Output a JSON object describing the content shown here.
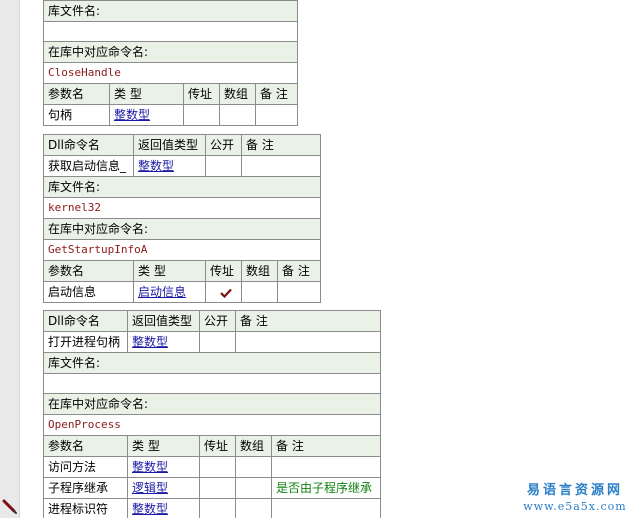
{
  "gutter": {
    "marker_icon": "pencil-icon"
  },
  "block1": {
    "lib_label": "库文件名:",
    "lib_value": "",
    "cmd_label": "在库中对应命令名:",
    "cmd_value": "CloseHandle",
    "param_headers": [
      "参数名",
      "类 型",
      "传址",
      "数组",
      "备 注"
    ],
    "params": [
      {
        "name": "句柄",
        "type": "整数型",
        "byref": "",
        "array": "",
        "note": ""
      }
    ]
  },
  "block2": {
    "headers": [
      "Dll命令名",
      "返回值类型",
      "公开",
      "备 注"
    ],
    "name": "获取启动信息_",
    "return_type": "整数型",
    "public": "",
    "note": "",
    "lib_label": "库文件名:",
    "lib_value": "kernel32",
    "cmd_label": "在库中对应命令名:",
    "cmd_value": "GetStartupInfoA",
    "param_headers": [
      "参数名",
      "类 型",
      "传址",
      "数组",
      "备 注"
    ],
    "params": [
      {
        "name": "启动信息",
        "type": "启动信息",
        "byref": "check",
        "array": "",
        "note": ""
      }
    ]
  },
  "block3": {
    "headers": [
      "Dll命令名",
      "返回值类型",
      "公开",
      "备 注"
    ],
    "name": "打开进程句柄",
    "return_type": "整数型",
    "public": "",
    "note": "",
    "lib_label": "库文件名:",
    "lib_value": "",
    "cmd_label": "在库中对应命令名:",
    "cmd_value": "OpenProcess",
    "param_headers": [
      "参数名",
      "类 型",
      "传址",
      "数组",
      "备 注"
    ],
    "params": [
      {
        "name": "访问方法",
        "type": "整数型",
        "byref": "",
        "array": "",
        "note": ""
      },
      {
        "name": "子程序继承",
        "type": "逻辑型",
        "byref": "",
        "array": "",
        "note": "是否由子程序继承"
      },
      {
        "name": "进程标识符",
        "type": "整数型",
        "byref": "",
        "array": "",
        "note": ""
      }
    ]
  },
  "watermark": {
    "title": "易语言资源网",
    "url": "www.e5a5x.com",
    "color": "#2b7fc7"
  },
  "colors": {
    "header_bg": "#eaf1e6",
    "border": "#8c8c8c",
    "type_link": "#1a1aa6",
    "code_text": "#8b1a1a",
    "note_green": "#108010"
  }
}
